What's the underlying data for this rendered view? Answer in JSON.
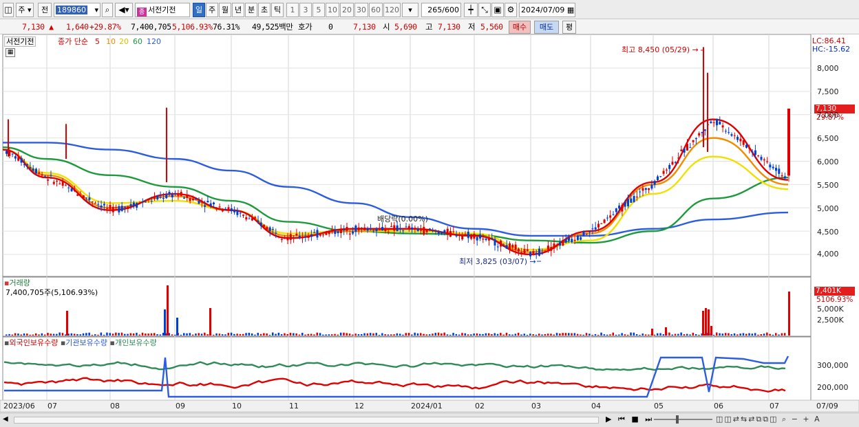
{
  "toolbar": {
    "market": "주",
    "prev_label": "전",
    "code": "189860",
    "stock_name": "서전기전",
    "name_tag": "종",
    "periods": [
      "일",
      "주",
      "월",
      "년",
      "분",
      "초",
      "틱"
    ],
    "active_period": "일",
    "intervals": [
      "1",
      "3",
      "5",
      "10",
      "20",
      "30",
      "60",
      "120"
    ],
    "count": "265",
    "count_total": "/600",
    "date": "2024/07/09"
  },
  "quote": {
    "price": "7,130",
    "change": "1,640",
    "change_pct": "+29.87%",
    "volume": "7,400,705",
    "volume_pct": "5,106.93%",
    "turnover_pct": "76.31%",
    "amount": "49,525백만",
    "hoga_label": "호가",
    "hoga_value": "0",
    "hoga_price": "7,130",
    "open_label": "시",
    "open": "5,690",
    "high_label": "고",
    "high": "7,130",
    "low_label": "저",
    "low": "5,560",
    "buy_label": "매수",
    "sell_label": "매도",
    "flat_label": "평"
  },
  "price_panel": {
    "stock_label": "서전기전",
    "ma_title": "종가 단순",
    "ma_periods": [
      "5",
      "10",
      "20",
      "60",
      "120"
    ],
    "lc": "LC:86.41",
    "hc": "HC:-15.62",
    "high_annotation": "최고 8,450 (05/29)",
    "low_annotation": "최저 3,825 (03/07)",
    "dividend_annotation": "배당락(0.00%)",
    "current_price_tag": "7,130",
    "current_pct_tag": "29.87%",
    "y_ticks": [
      "8,000",
      "7,500",
      "7,000",
      "6,500",
      "6,000",
      "5,500",
      "5,000",
      "4,500",
      "4,000"
    ]
  },
  "volume_panel": {
    "title": "거래량",
    "value_text": "7,400,705주(5,106.93%)",
    "tag_value": "7,401K",
    "tag_pct": "5106.93%",
    "y_ticks": [
      "5,000K",
      "2,500K"
    ]
  },
  "holdings_panel": {
    "series_labels": [
      "외국인보유수량",
      "기관보유수량",
      "개인보유수량"
    ],
    "y_ticks": [
      "300,000",
      "200,000"
    ]
  },
  "x_axis": [
    "2023/06",
    "07",
    "08",
    "09",
    "10",
    "11",
    "12",
    "2024/01",
    "02",
    "03",
    "04",
    "05",
    "06",
    "07",
    "07/09"
  ],
  "colors": {
    "up": "#e00000",
    "down": "#0040d0",
    "ma5": "#e00000",
    "ma10": "#f08c00",
    "ma20": "#f0e000",
    "ma60": "#1c9a3c",
    "ma120": "#2c5ce0",
    "foreign": "#e00000",
    "institution": "#2c5ce0",
    "individual": "#2e8b57"
  },
  "chart_data": {
    "type": "line",
    "title": "서전기전",
    "x": [
      "2023/06",
      "07",
      "08",
      "09",
      "10",
      "11",
      "12",
      "2024/01",
      "02",
      "03",
      "04",
      "05",
      "06",
      "07"
    ],
    "ylim": [
      3700,
      8600
    ],
    "series": [
      {
        "name": "5",
        "values": [
          6250,
          5650,
          4950,
          5300,
          4950,
          4350,
          4550,
          4550,
          4400,
          4000,
          4500,
          5550,
          6900,
          5600
        ]
      },
      {
        "name": "10",
        "values": [
          6250,
          5700,
          5000,
          5250,
          4950,
          4400,
          4500,
          4550,
          4400,
          4050,
          4450,
          5500,
          6500,
          5500
        ]
      },
      {
        "name": "20",
        "values": [
          6250,
          5750,
          5100,
          5150,
          4950,
          4450,
          4500,
          4500,
          4450,
          4100,
          4300,
          5300,
          6100,
          5400
        ]
      },
      {
        "name": "60",
        "values": [
          6300,
          6050,
          5700,
          5450,
          5150,
          4700,
          4500,
          4450,
          4420,
          4300,
          4250,
          4500,
          5200,
          5650
        ]
      },
      {
        "name": "120",
        "values": [
          6400,
          6400,
          6250,
          6050,
          5800,
          5450,
          5100,
          4800,
          4550,
          4400,
          4400,
          4550,
          4750,
          4900
        ]
      }
    ],
    "ohlc_last": {
      "open": 5690,
      "high": 7130,
      "low": 5560,
      "close": 7130
    },
    "high_point": {
      "x": "05/29",
      "value": 8450
    },
    "low_point": {
      "x": "03/07",
      "value": 3825
    },
    "volume_last": 7400705
  }
}
